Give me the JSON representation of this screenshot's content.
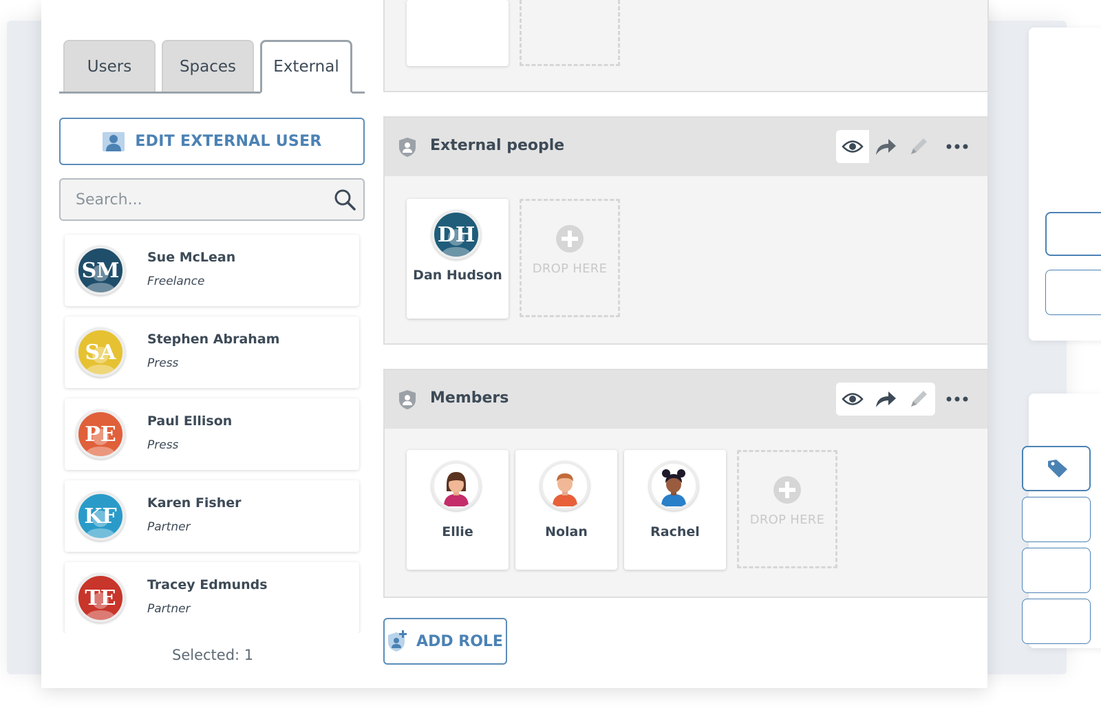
{
  "tabs": [
    {
      "label": "Users"
    },
    {
      "label": "Spaces"
    },
    {
      "label": "External"
    }
  ],
  "edit_button": {
    "label": "EDIT EXTERNAL USER",
    "icon": "user-icon"
  },
  "search": {
    "placeholder": "Search...",
    "icon": "search-icon"
  },
  "users": [
    {
      "initials": "SM",
      "name": "Sue McLean",
      "role": "Freelance",
      "color": "#1f4e6b"
    },
    {
      "initials": "SA",
      "name": "Stephen Abraham",
      "role": "Press",
      "color": "#e6c232"
    },
    {
      "initials": "PE",
      "name": "Paul Ellison",
      "role": "Press",
      "color": "#e0603a"
    },
    {
      "initials": "KF",
      "name": "Karen Fisher",
      "role": "Partner",
      "color": "#2a9bc9"
    },
    {
      "initials": "TE",
      "name": "Tracey Edmunds",
      "role": "Partner",
      "color": "#c8352a"
    }
  ],
  "selected_text": "Selected: 1",
  "roles": [
    {
      "title": "External people",
      "members": [
        {
          "initials": "DH",
          "name": "Dan Hudson",
          "color": "#1f5d7a"
        }
      ],
      "drop_label": "DROP HERE"
    },
    {
      "title": "Members",
      "members": [
        {
          "name": "Ellie",
          "avatar": "girl-avatar"
        },
        {
          "name": "Nolan",
          "avatar": "boy-avatar"
        },
        {
          "name": "Rachel",
          "avatar": "girl-buns-avatar"
        }
      ],
      "drop_label": "DROP HERE"
    }
  ],
  "add_role": {
    "label": "ADD ROLE",
    "icon": "shield-plus-icon"
  },
  "colors": {
    "accent": "#4b82b4",
    "text": "#3d4a57"
  }
}
